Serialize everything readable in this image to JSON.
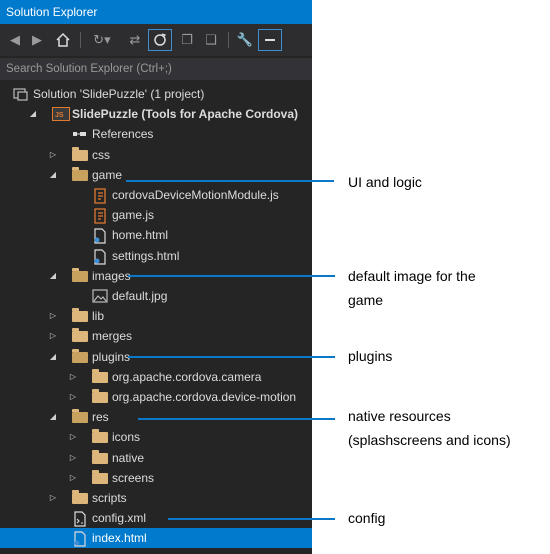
{
  "title": "Solution Explorer",
  "search_placeholder": "Search Solution Explorer (Ctrl+;)",
  "tree": [
    {
      "label": "Solution 'SlidePuzzle' (1 project)",
      "icon": "solution-icon",
      "indent": 0,
      "arrow": ""
    },
    {
      "label": "SlidePuzzle (Tools for Apache Cordova)",
      "icon": "js-project-icon",
      "indent": 0,
      "arrow": "expanded",
      "bold": true
    },
    {
      "label": "References",
      "icon": "references-icon",
      "indent": 1,
      "arrow": ""
    },
    {
      "label": "css",
      "icon": "folder-icon",
      "indent": 1,
      "arrow": "collapsed"
    },
    {
      "label": "game",
      "icon": "folder-open-icon",
      "indent": 1,
      "arrow": "expanded"
    },
    {
      "label": "cordovaDeviceMotionModule.js",
      "icon": "js-file-icon",
      "indent": 2,
      "arrow": ""
    },
    {
      "label": "game.js",
      "icon": "js-file-icon",
      "indent": 2,
      "arrow": ""
    },
    {
      "label": "home.html",
      "icon": "html-file-icon",
      "indent": 2,
      "arrow": ""
    },
    {
      "label": "settings.html",
      "icon": "html-file-icon",
      "indent": 2,
      "arrow": ""
    },
    {
      "label": "images",
      "icon": "folder-open-icon",
      "indent": 1,
      "arrow": "expanded"
    },
    {
      "label": "default.jpg",
      "icon": "image-file-icon",
      "indent": 2,
      "arrow": ""
    },
    {
      "label": "lib",
      "icon": "folder-icon",
      "indent": 1,
      "arrow": "collapsed"
    },
    {
      "label": "merges",
      "icon": "folder-icon",
      "indent": 1,
      "arrow": "collapsed"
    },
    {
      "label": "plugins",
      "icon": "folder-open-icon",
      "indent": 1,
      "arrow": "expanded"
    },
    {
      "label": "org.apache.cordova.camera",
      "icon": "folder-icon",
      "indent": 2,
      "arrow": "collapsed"
    },
    {
      "label": "org.apache.cordova.device-motion",
      "icon": "folder-icon",
      "indent": 2,
      "arrow": "collapsed"
    },
    {
      "label": "res",
      "icon": "folder-open-icon",
      "indent": 1,
      "arrow": "expanded"
    },
    {
      "label": "icons",
      "icon": "folder-icon",
      "indent": 2,
      "arrow": "collapsed"
    },
    {
      "label": "native",
      "icon": "folder-icon",
      "indent": 2,
      "arrow": "collapsed"
    },
    {
      "label": "screens",
      "icon": "folder-icon",
      "indent": 2,
      "arrow": "collapsed"
    },
    {
      "label": "scripts",
      "icon": "folder-icon",
      "indent": 1,
      "arrow": "collapsed"
    },
    {
      "label": "config.xml",
      "icon": "xml-file-icon",
      "indent": 1,
      "arrow": ""
    },
    {
      "label": "index.html",
      "icon": "html-file-icon",
      "indent": 1,
      "arrow": "",
      "selected": true
    }
  ],
  "annotations": {
    "ui_logic": "UI and logic",
    "default_image_1": "default image for the",
    "default_image_2": "game",
    "plugins": "plugins",
    "native_1": "native resources",
    "native_2": "(splashscreens and icons)",
    "config": "config"
  },
  "colors": {
    "accent": "#007acc",
    "panel": "#252526",
    "callout": "#0b78c8"
  }
}
